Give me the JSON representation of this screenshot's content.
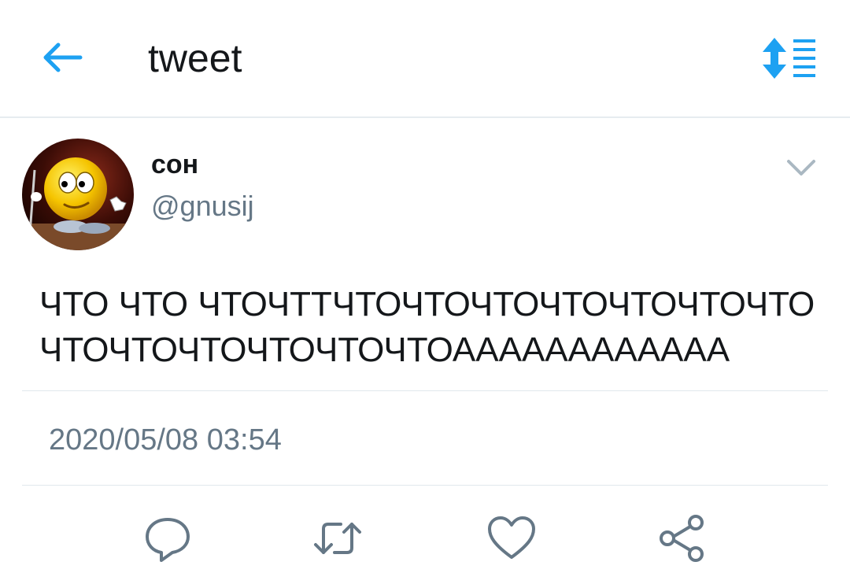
{
  "header": {
    "title": "tweet",
    "back_icon": "arrow-left-icon",
    "sort_icon": "sort-list-icon",
    "accent": "#1da1f2"
  },
  "tweet": {
    "author_name": "сон",
    "author_handle": "@gnusij",
    "avatar_icon": "smiley-avatar-image",
    "text": "ЧТО ЧТО ЧТОЧТТЧТОЧТОЧТОЧТОЧТОЧТОЧТОЧТОЧТОЧТОЧТОЧТОЧТОАААААААААААА",
    "timestamp": "2020/05/08 03:54",
    "menu_icon": "chevron-down-icon"
  },
  "actions": [
    {
      "name": "reply",
      "icon": "reply-icon"
    },
    {
      "name": "retweet",
      "icon": "retweet-icon"
    },
    {
      "name": "like",
      "icon": "heart-icon"
    },
    {
      "name": "share",
      "icon": "share-icon"
    }
  ],
  "colors": {
    "text": "#14171a",
    "secondary": "#657786",
    "icon_gray": "#657786",
    "divider": "#e1e8ed"
  }
}
